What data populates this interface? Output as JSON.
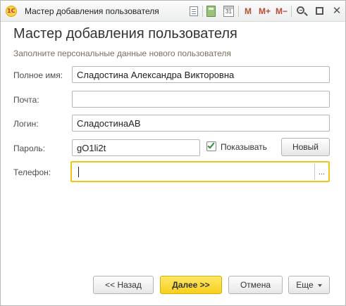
{
  "window": {
    "title": "Мастер добавления пользователя",
    "logo_text": "1С",
    "toolbar": {
      "calendar_day": "31",
      "m_label": "M",
      "m_plus_label": "M+",
      "m_minus_label": "M−",
      "close_glyph": "✕"
    }
  },
  "form": {
    "heading": "Мастер добавления пользователя",
    "subtitle": "Заполните персональные данные нового пользователя",
    "full_name": {
      "label": "Полное имя:",
      "value": "Сладостина Александра Викторовна"
    },
    "email": {
      "label": "Почта:",
      "value": ""
    },
    "login": {
      "label": "Логин:",
      "value": "СладостинаАВ"
    },
    "password": {
      "label": "Пароль:",
      "value": "gO1li2t",
      "show_checkbox_label": "Показывать",
      "show_checked": true,
      "new_button": "Новый"
    },
    "phone": {
      "label": "Телефон:",
      "value": "",
      "select_button": "..."
    }
  },
  "footer": {
    "back_button": "<< Назад",
    "next_button": "Далее >>",
    "cancel_button": "Отмена",
    "more_button": "Еще"
  },
  "colors": {
    "accent": "#f7cf1c",
    "focus_border": "#f0c419",
    "check_green": "#2e8b2e"
  }
}
